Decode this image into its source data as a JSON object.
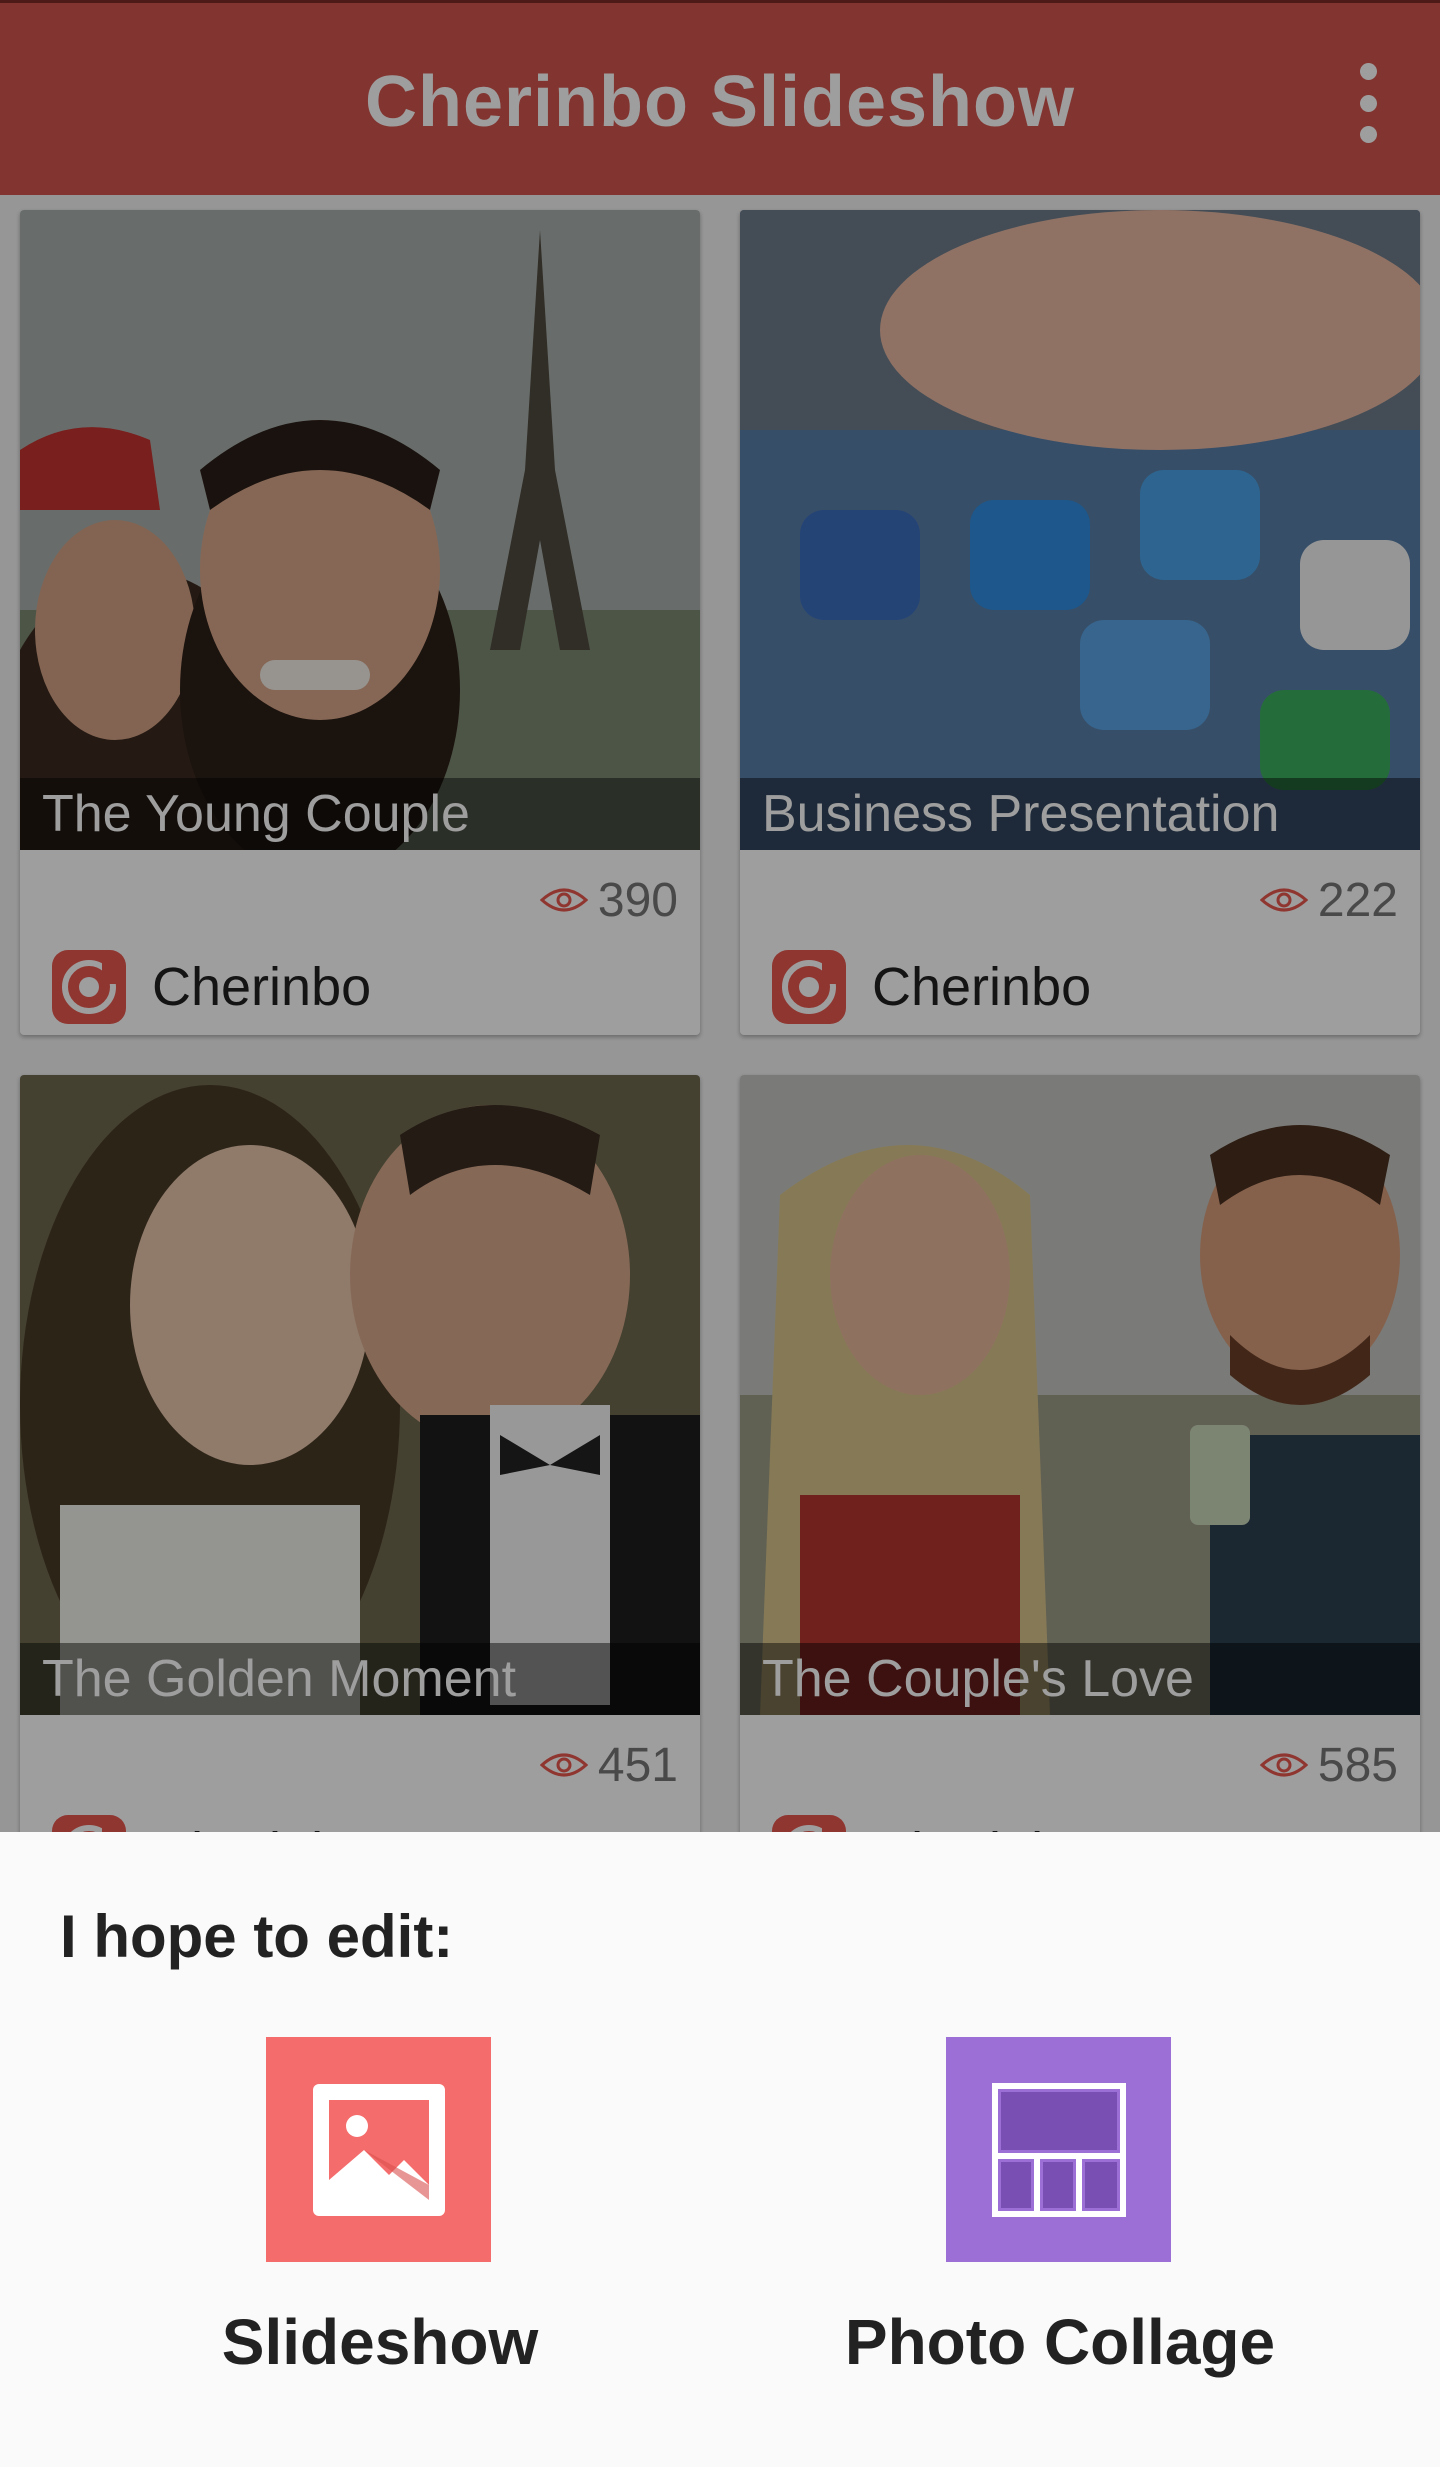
{
  "app_bar": {
    "title": "Cherinbo Slideshow",
    "menu_icon": "more-vert-icon"
  },
  "cards": [
    {
      "title": "The Young Couple",
      "views": "390",
      "author": "Cherinbo"
    },
    {
      "title": "Business Presentation",
      "views": "222",
      "author": "Cherinbo"
    },
    {
      "title": "The Golden Moment",
      "views": "451",
      "author": "Cherinbo"
    },
    {
      "title": "The Couple's Love",
      "views": "585",
      "author": "Cherinbo"
    }
  ],
  "sheet": {
    "heading": "I hope to edit:",
    "options": [
      {
        "label": "Slideshow",
        "icon": "image-icon",
        "color": "#f46c6b"
      },
      {
        "label": "Photo Collage",
        "icon": "collage-icon",
        "color": "#9b6fd6"
      }
    ]
  },
  "colors": {
    "app_bar": "#d2564e",
    "accent": "#e8574e"
  }
}
